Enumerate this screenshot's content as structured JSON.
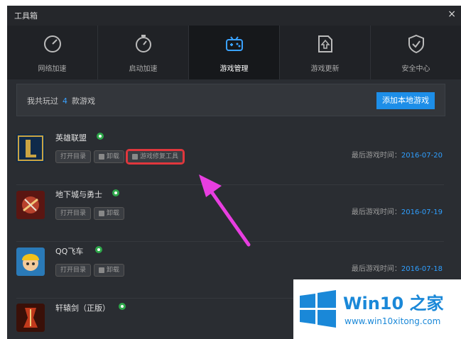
{
  "window": {
    "title": "工具箱",
    "close_glyph": "×"
  },
  "tabs": [
    {
      "label": "网络加速",
      "icon": "speedometer-icon"
    },
    {
      "label": "启动加速",
      "icon": "stopwatch-icon"
    },
    {
      "label": "游戏管理",
      "icon": "gamepad-icon",
      "active": true
    },
    {
      "label": "游戏更新",
      "icon": "update-icon"
    },
    {
      "label": "安全中心",
      "icon": "shield-icon"
    }
  ],
  "summary": {
    "prefix": "我共玩过",
    "count": "4",
    "suffix": "款游戏",
    "add_button": "添加本地游戏"
  },
  "games": [
    {
      "name": "英雄联盟",
      "open": "打开目录",
      "uninstall": "卸载",
      "repair": "游戏修复工具",
      "last_label": "最后游戏时间：",
      "last_date": "2016-07-20"
    },
    {
      "name": "地下城与勇士",
      "open": "打开目录",
      "uninstall": "卸载",
      "last_label": "最后游戏时间：",
      "last_date": "2016-07-19"
    },
    {
      "name": "QQ飞车",
      "open": "打开目录",
      "uninstall": "卸载",
      "last_label": "最后游戏时间：",
      "last_date": "2016-07-18"
    },
    {
      "name": "轩辕剑（正版）"
    }
  ],
  "watermark": {
    "title": "Win10 之家",
    "url": "www.win10xitong.com"
  },
  "colors": {
    "accent": "#1d8ee8",
    "date": "#2f9fff",
    "highlight": "#e1373d",
    "arrow": "#e83ee0"
  }
}
